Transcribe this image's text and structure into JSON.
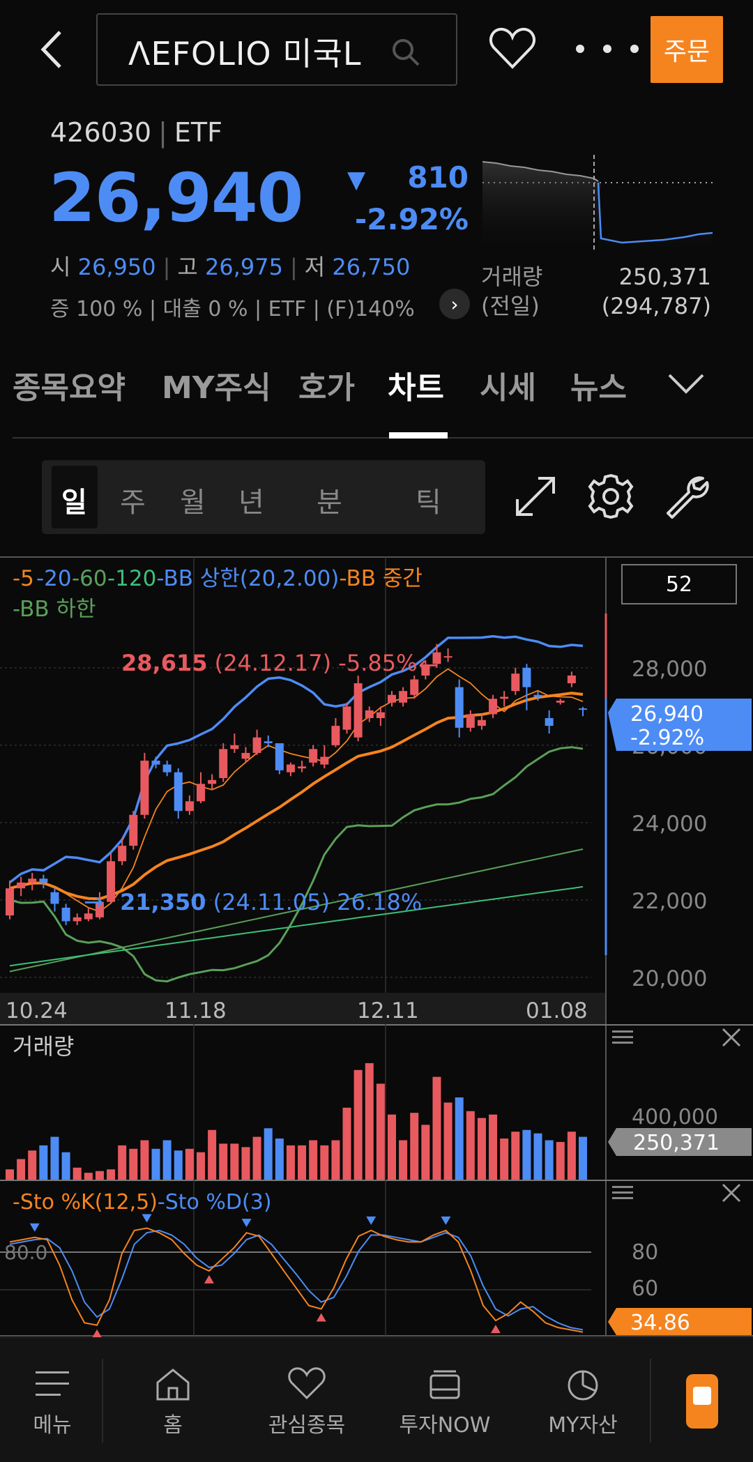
{
  "header": {
    "search_text": "ΛEFOLIO 미국L",
    "order_label": "주문"
  },
  "stock": {
    "code": "426030",
    "type": "ETF",
    "price": "26,940",
    "change": "810",
    "change_pct": "-2.92%",
    "open_label": "시",
    "open": "26,950",
    "high_label": "고",
    "high": "26,975",
    "low_label": "저",
    "low": "26,750",
    "meta": "증 100 % | 대출 0 % | ETF | (F)140%",
    "volume_label": "거래량",
    "prev_label": "(전일)",
    "volume": "250,371",
    "prev_volume": "(294,787)"
  },
  "tabs": [
    "종목요약",
    "MY주식",
    "호가",
    "차트",
    "시세",
    "뉴스"
  ],
  "active_tab": "차트",
  "periods": [
    "일",
    "주",
    "월",
    "년",
    "분",
    "틱"
  ],
  "active_period": "일",
  "colors": {
    "up": "#e85a5f",
    "down": "#4d8cf5",
    "accent": "#f5841f",
    "ma5": "#f5841f",
    "ma20": "#4d8cf5",
    "ma60": "#5aa05a",
    "ma120": "#3cbf7a"
  },
  "chart": {
    "legend": [
      {
        "t": "-5",
        "c": "#f5841f"
      },
      {
        "t": "-20",
        "c": "#4d8cf5"
      },
      {
        "t": "-60",
        "c": "#5aa05a"
      },
      {
        "t": "-120",
        "c": "#3cbf7a"
      },
      {
        "t": "-BB 상한(20,2.00)",
        "c": "#4d8cf5"
      },
      {
        "t": "-BB 중간",
        "c": "#f5841f"
      }
    ],
    "legend2": "-BB 하한",
    "count": "52",
    "high_ann": {
      "value": "28,615",
      "date": "(24.12.17)",
      "pct": "-5.85%"
    },
    "low_ann": {
      "value": "21,350",
      "date": "(24.11.05)",
      "pct": "26.18%"
    },
    "y_ticks": [
      "28,000",
      "26,000",
      "24,000",
      "22,000",
      "20,000"
    ],
    "y_values": [
      28000,
      26000,
      24000,
      22000,
      20000
    ],
    "x_labels": [
      "10.24",
      "11.18",
      "12.11",
      "01.08"
    ],
    "price_tag": "26,940",
    "price_tag_pct": "-2.92%",
    "volume_title": "거래량",
    "volume_tick": "400,000",
    "volume_tag": "250,371",
    "sto_title_k": "-Sto %K(12,5)",
    "sto_title_d": "-Sto %D(3)",
    "sto_level": "80.0",
    "sto_ticks": [
      "80",
      "60"
    ],
    "sto_tag": "34.86"
  },
  "chart_data": {
    "type": "candlestick",
    "candles": [
      [
        21600,
        22500,
        21500,
        22300
      ],
      [
        22300,
        22600,
        22100,
        22450
      ],
      [
        22450,
        22700,
        22250,
        22550
      ],
      [
        22550,
        22650,
        22300,
        22450
      ],
      [
        22200,
        22300,
        21700,
        21900
      ],
      [
        21800,
        21900,
        21350,
        21450
      ],
      [
        21450,
        21650,
        21350,
        21550
      ],
      [
        21500,
        21800,
        21450,
        21650
      ],
      [
        21550,
        22200,
        21500,
        21950
      ],
      [
        21950,
        23200,
        21900,
        23000
      ],
      [
        23000,
        23600,
        22900,
        23400
      ],
      [
        23400,
        24300,
        23300,
        24200
      ],
      [
        24200,
        25800,
        24100,
        25600
      ],
      [
        25600,
        25700,
        25400,
        25500
      ],
      [
        25500,
        25600,
        25200,
        25300
      ],
      [
        25300,
        25400,
        24100,
        24300
      ],
      [
        24300,
        24700,
        24200,
        24550
      ],
      [
        24550,
        25300,
        24500,
        25000
      ],
      [
        25000,
        25250,
        24850,
        25100
      ],
      [
        25150,
        26050,
        25050,
        25900
      ],
      [
        25900,
        26300,
        25800,
        26000
      ],
      [
        25650,
        25950,
        25550,
        25800
      ],
      [
        25800,
        26400,
        25750,
        26200
      ],
      [
        26100,
        26250,
        25950,
        26050
      ],
      [
        26050,
        25900,
        25250,
        25350
      ],
      [
        25300,
        25550,
        25200,
        25500
      ],
      [
        25400,
        25600,
        25300,
        25450
      ],
      [
        25550,
        26000,
        25450,
        25900
      ],
      [
        25500,
        26000,
        25400,
        25700
      ],
      [
        26000,
        26700,
        25950,
        26500
      ],
      [
        26400,
        27100,
        26300,
        27000
      ],
      [
        26200,
        27800,
        26100,
        27600
      ],
      [
        26700,
        27000,
        26600,
        26900
      ],
      [
        26700,
        27000,
        26500,
        26850
      ],
      [
        27100,
        27400,
        27000,
        27300
      ],
      [
        27100,
        27500,
        27000,
        27400
      ],
      [
        27300,
        27800,
        27200,
        27700
      ],
      [
        27800,
        28200,
        27700,
        28050
      ],
      [
        28100,
        28615,
        28000,
        28400
      ],
      [
        28300,
        28500,
        28150,
        28300
      ],
      [
        27500,
        27700,
        26200,
        26450
      ],
      [
        26450,
        26900,
        26350,
        26800
      ],
      [
        26500,
        26800,
        26400,
        26650
      ],
      [
        26800,
        27300,
        26700,
        27200
      ],
      [
        27200,
        27400,
        27000,
        27250
      ],
      [
        27400,
        28000,
        27300,
        27850
      ],
      [
        28000,
        28100,
        26900,
        27500
      ],
      [
        27300,
        27400,
        27150,
        27250
      ],
      [
        26700,
        26900,
        26300,
        26500
      ],
      [
        27100,
        27200,
        27050,
        27150
      ],
      [
        27600,
        27900,
        27500,
        27800
      ],
      [
        26950,
        26990,
        26750,
        26940
      ]
    ],
    "y_range": [
      19600,
      28700
    ],
    "volume": [
      60,
      120,
      170,
      200,
      250,
      160,
      70,
      40,
      50,
      60,
      200,
      180,
      230,
      180,
      230,
      170,
      180,
      160,
      290,
      210,
      210,
      190,
      250,
      300,
      240,
      200,
      200,
      230,
      200,
      230,
      420,
      640,
      680,
      560,
      380,
      230,
      390,
      320,
      600,
      450,
      480,
      400,
      360,
      380,
      240,
      280,
      290,
      270,
      230,
      220,
      280,
      250
    ],
    "volume_range": [
      0,
      700
    ],
    "sto_k": [
      80,
      82,
      84,
      82,
      60,
      30,
      10,
      8,
      30,
      70,
      90,
      92,
      88,
      82,
      70,
      60,
      55,
      65,
      75,
      88,
      85,
      70,
      55,
      40,
      25,
      22,
      40,
      65,
      85,
      90,
      85,
      82,
      80,
      80,
      86,
      90,
      80,
      55,
      25,
      12,
      18,
      28,
      20,
      10,
      6,
      4,
      2
    ],
    "sto_d": [
      78,
      80,
      82,
      83,
      75,
      55,
      28,
      15,
      22,
      48,
      78,
      88,
      90,
      86,
      78,
      66,
      58,
      60,
      70,
      82,
      86,
      78,
      65,
      52,
      38,
      28,
      32,
      50,
      72,
      86,
      86,
      84,
      82,
      80,
      84,
      88,
      84,
      68,
      42,
      22,
      16,
      22,
      24,
      16,
      10,
      6,
      4
    ],
    "sto_range": [
      0,
      105
    ]
  },
  "nav": [
    "메뉴",
    "홈",
    "관심종목",
    "투자NOW",
    "MY자산"
  ]
}
